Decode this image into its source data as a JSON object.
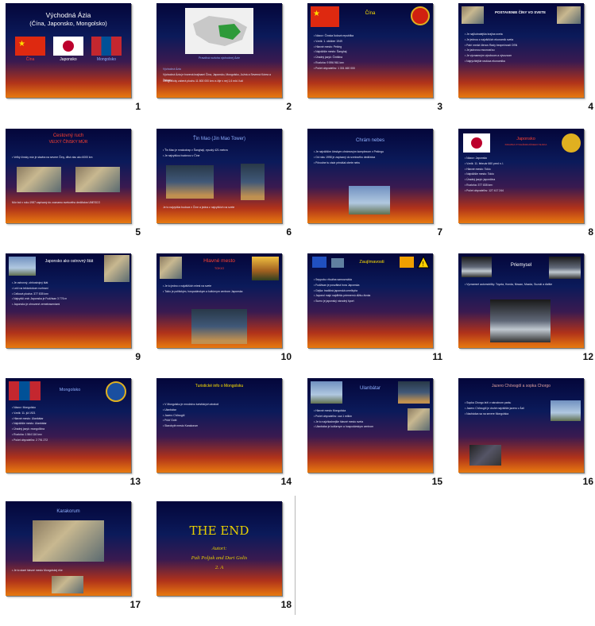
{
  "slides": [
    {
      "num": "1",
      "title": "Východná Ázia",
      "subtitle": "(Čína, Japonsko, Mongolsko)",
      "labels": [
        "Čína",
        "Japonsko",
        "Mongolsko"
      ]
    },
    {
      "num": "2",
      "caption": "Pravdivá rozloha východnej Ázie",
      "lines": [
        "Východná Ázia",
        "Východná Ázia je tvorená krajinami Čína, Japonsko, Mongolsko, Južná a Severná Kórea a Taiwan",
        "Geograficky zaberá plochu 11 800 000 km² a žije v nej 1,6 mld. ľudí"
      ]
    },
    {
      "num": "3",
      "title": "Čína",
      "bullets": [
        "Názov: Čínska ľudová republika",
        "Vznik: 1. október 1949",
        "Hlavné mesto: Peking",
        "Najväčšie mesto: Šanghaj",
        "Úradný jazyk: Čínština",
        "Rozloha: 9 596 961 km²",
        "Počet obyvateľov: 1 331 460 000"
      ]
    },
    {
      "num": "4",
      "title": "POSTAVENIE ČÍNY VO SVETE",
      "bullets": [
        "Je najľudnatejšia krajina sveta",
        "Je jednou z najväčších ekonomík sveta",
        "Patrí medzi členov Rady bezpečnosti OSN",
        "Je jadrovou mocnosťou",
        "Je významným výrobcom a vývozcom",
        "Najrýchlejšie rastúca ekonomika"
      ]
    },
    {
      "num": "5",
      "title": "Cestovný ruch",
      "subtitle": "VEĽKÝ ČÍNSKY MÚR",
      "bullets": [
        "Veľký čínsky múr je stavba na severe Číny, dlhá viac ako 6000 km"
      ],
      "footer": "Múr bol v roku 1987 zapísaný do zoznamu svetového dedičstva UNESCO"
    },
    {
      "num": "6",
      "title": "Ťin Mao (Jin Mao Tower)",
      "bullets": [
        "Ťin Mao je mrakodrap v Šanghaji, vysoký 421 metrov",
        "Je najvyššou budovou v Číne"
      ],
      "footer": "Je to najvyššia budova v Číne a jedna z najvyšších na svete"
    },
    {
      "num": "7",
      "title": "Chrám nebes",
      "bullets": [
        "Je najväčším čínskym chrámovým komplexom v Pekingu",
        "Od roku 1998 je zapísaný do svetového dedičstva",
        "Pôvodne tu cisár prinášal obete nebu"
      ]
    },
    {
      "num": "8",
      "title": "Japonsko",
      "subtitle": "KRAJINA VYCHÁDZAJÚCEHO SLNKA",
      "bullets": [
        "Názov: Japonsko",
        "Vznik: 11. február 660 pred n. l.",
        "Hlavné mesto: Tokio",
        "Najväčšie mesto: Tokio",
        "Úradný jazyk: japončina",
        "Rozloha: 377 835 km²",
        "Počet obyvateľov: 127 417 244"
      ]
    },
    {
      "num": "9",
      "title": "Japonsko ako ostrovný štát",
      "bullets": [
        "Je ostrovný, ohňostrojný štát",
        "Leží na tektonickom rozhraní",
        "Celková plocha: 377 835 km²",
        "Najvyšší vrch Japonska je Fudžisan 3 776 m",
        "Japonsko je ohrozené zemetraseniami"
      ]
    },
    {
      "num": "10",
      "title": "Hlavné mesto",
      "subtitle": "TOKIO",
      "bullets": [
        "Je to jedno z najväčších miest na svete",
        "Tokio je politickým, hospodárskym a kultúrnym centrom Japonska"
      ]
    },
    {
      "num": "11",
      "title": "Zaujímavosti",
      "bullets": [
        "Seppuku: rituálna samovražda",
        "Fudžisan je posvätná hora Japonska",
        "Gejša: tradičná japonská umelkyňa",
        "Japonci majú najdlhšiu priemernú dĺžku života",
        "Sumo je japonský národný šport"
      ]
    },
    {
      "num": "12",
      "title": "Priemysel",
      "bullets": [
        "Významné automobilky: Toyota, Honda, Nissan, Mazda, Suzuki a ďalšie"
      ]
    },
    {
      "num": "13",
      "title": "Mongolsko",
      "bullets": [
        "Názov: Mongolsko",
        "Vznik: 11. júl 1921",
        "Hlavné mesto: Ulanbátar",
        "Najväčšie mesto: Ulanbátar",
        "Úradný jazyk: mongolčina",
        "Rozloha: 1 564 116 km²",
        "Počet obyvateľov: 2 791 272"
      ]
    },
    {
      "num": "14",
      "title": "Turistické info o Mongolsku",
      "bullets": [
        "V Mongolsku je množstvo turistických atrakcií",
        "Ulanbátar",
        "Jazero Chövsgöl",
        "Púšť Gobi",
        "Starobylé mesto Karakorum"
      ]
    },
    {
      "num": "15",
      "title": "Ulanbátar",
      "bullets": [
        "Hlavné mesto Mongolska",
        "Počet obyvateľov: cca 1 milión",
        "Je to najchladnejšie hlavné mesto sveta",
        "Ulanbátar je kultúrnym a hospodárskym centrom"
      ]
    },
    {
      "num": "16",
      "title": "Jazero Chövsgöl a sopka Chorgo",
      "bullets": [
        "Sopka Chorgo leží v národnom parku",
        "Jazero Chövsgöl je druhé najväčšie jazero v Ázii",
        "Nachádza sa na severe Mongolska"
      ]
    },
    {
      "num": "17",
      "title": "Karakorum",
      "bullets": [
        "Je to staré hlavné mesto Mongolskej ríše"
      ]
    },
    {
      "num": "18",
      "title": "THE END",
      "lines": [
        "Autori:",
        "Pali Poljak and Duri Golis",
        "2. A"
      ]
    }
  ]
}
